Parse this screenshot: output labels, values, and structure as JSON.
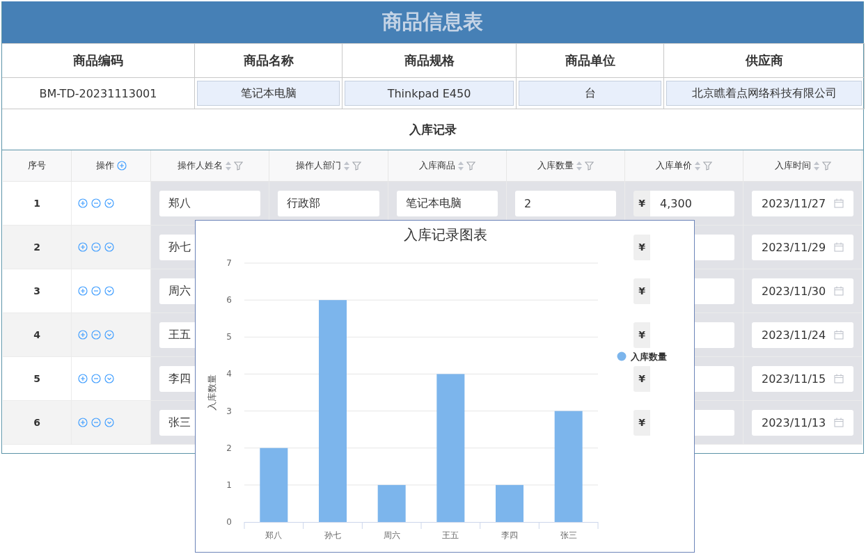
{
  "title": "商品信息表",
  "product": {
    "columns": [
      "商品编码",
      "商品名称",
      "商品规格",
      "商品单位",
      "供应商"
    ],
    "values": [
      {
        "text": "BM-TD-20231113001",
        "kind": "plain"
      },
      {
        "text": "笔记本电脑",
        "kind": "field"
      },
      {
        "text": "Thinkpad E450",
        "kind": "field"
      },
      {
        "text": "台",
        "kind": "field"
      },
      {
        "text": "北京瞧着点网络科技有限公司",
        "kind": "field"
      }
    ]
  },
  "section_title": "入库记录",
  "records": {
    "columns": [
      {
        "label": "序号",
        "kind": "plain"
      },
      {
        "label": "操作",
        "kind": "add"
      },
      {
        "label": "操作人姓名",
        "kind": "sortfilter"
      },
      {
        "label": "操作人部门",
        "kind": "sortfilter"
      },
      {
        "label": "入库商品",
        "kind": "sortfilter"
      },
      {
        "label": "入库数量",
        "kind": "sortfilter"
      },
      {
        "label": "入库单价",
        "kind": "sortfilter"
      },
      {
        "label": "入库时间",
        "kind": "sortfilter"
      }
    ],
    "rows": [
      {
        "index": "1",
        "name": "郑八",
        "department": "行政部",
        "product": "笔记本电脑",
        "quantity": "2",
        "currency": "¥",
        "price": "4,300",
        "date": "2023/11/27"
      },
      {
        "index": "2",
        "name": "孙七",
        "currency": "¥",
        "date": "2023/11/29"
      },
      {
        "index": "3",
        "name": "周六",
        "currency": "¥",
        "date": "2023/11/30"
      },
      {
        "index": "4",
        "name": "王五",
        "currency": "¥",
        "date": "2023/11/24"
      },
      {
        "index": "5",
        "name": "李四",
        "currency": "¥",
        "date": "2023/11/15"
      },
      {
        "index": "6",
        "name": "张三",
        "currency": "¥",
        "date": "2023/11/13"
      }
    ]
  },
  "chart": {
    "chart_data": {
      "type": "bar",
      "title": "入库记录图表",
      "ylabel": "入库数量",
      "categories": [
        "郑八",
        "孙七",
        "周六",
        "王五",
        "李四",
        "张三"
      ],
      "series": [
        {
          "name": "入库数量",
          "color": "#7cb5ec",
          "values": [
            2,
            6,
            1,
            4,
            1,
            3
          ]
        }
      ],
      "ylim": [
        0,
        7
      ],
      "yticks": [
        0,
        1,
        2,
        3,
        4,
        5,
        6,
        7
      ],
      "grid": true
    }
  }
}
